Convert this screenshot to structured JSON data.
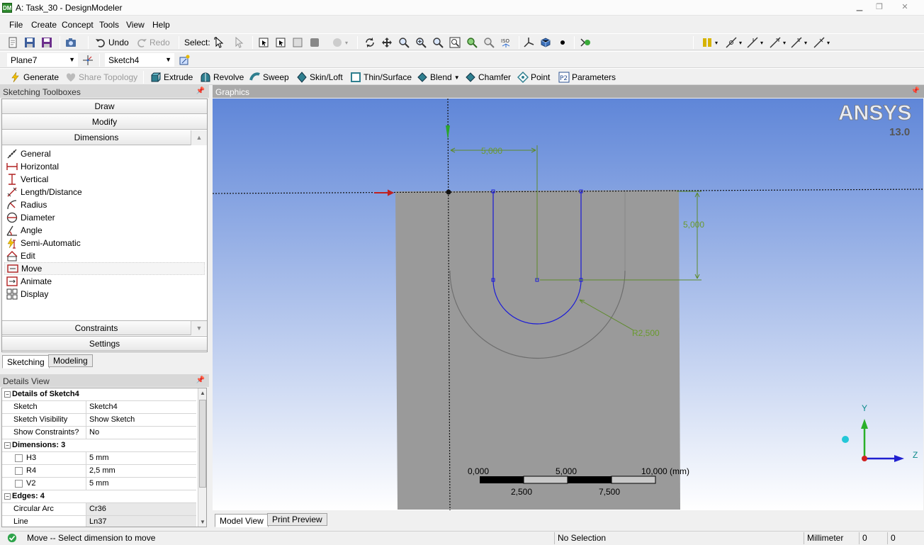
{
  "window": {
    "title": "A: Task_30 - DesignModeler",
    "app_icon": "DM"
  },
  "menu": [
    "File",
    "Create",
    "Concept",
    "Tools",
    "View",
    "Help"
  ],
  "toolbar1": {
    "undo": "Undo",
    "redo": "Redo",
    "select": "Select:"
  },
  "plane_combo": "Plane7",
  "sketch_combo": "Sketch4",
  "toolbar3": {
    "generate": "Generate",
    "share_topology": "Share Topology",
    "extrude": "Extrude",
    "revolve": "Revolve",
    "sweep": "Sweep",
    "skin_loft": "Skin/Loft",
    "thin_surface": "Thin/Surface",
    "blend": "Blend",
    "chamfer": "Chamfer",
    "point": "Point",
    "parameters": "Parameters"
  },
  "toolboxes": {
    "header": "Sketching Toolboxes",
    "draw": "Draw",
    "modify": "Modify",
    "dimensions": "Dimensions",
    "constraints": "Constraints",
    "settings": "Settings",
    "items": [
      "General",
      "Horizontal",
      "Vertical",
      "Length/Distance",
      "Radius",
      "Diameter",
      "Angle",
      "Semi-Automatic",
      "Edit",
      "Move",
      "Animate",
      "Display"
    ]
  },
  "tabs": {
    "sketching": "Sketching",
    "modeling": "Modeling"
  },
  "details": {
    "header": "Details View",
    "group1": "Details of Sketch4",
    "sketch_label": "Sketch",
    "sketch_value": "Sketch4",
    "visibility_label": "Sketch Visibility",
    "visibility_value": "Show Sketch",
    "constraints_label": "Show Constraints?",
    "constraints_value": "No",
    "group2": "Dimensions: 3",
    "h3_label": "H3",
    "h3_value": "5 mm",
    "r4_label": "R4",
    "r4_value": "2,5 mm",
    "v2_label": "V2",
    "v2_value": "5 mm",
    "group3": "Edges: 4",
    "arc_label": "Circular Arc",
    "arc_value": "Cr36",
    "line_label": "Line",
    "line_value": "Ln37"
  },
  "graphics": {
    "header": "Graphics",
    "logo": "ANSYS",
    "version": "13.0",
    "dim_h": "5,000",
    "dim_v": "5,000",
    "dim_r": "R2,500",
    "scale_0": "0,000",
    "scale_5": "5,000",
    "scale_10": "10,000 (mm)",
    "scale_2_5": "2,500",
    "scale_7_5": "7,500",
    "axis_y": "Y",
    "axis_z": "Z",
    "tab_model": "Model View",
    "tab_print": "Print Preview"
  },
  "status": {
    "message": "Move -- Select dimension to move",
    "selection": "No Selection",
    "units": "Millimeter",
    "v1": "0",
    "v2": "0"
  }
}
